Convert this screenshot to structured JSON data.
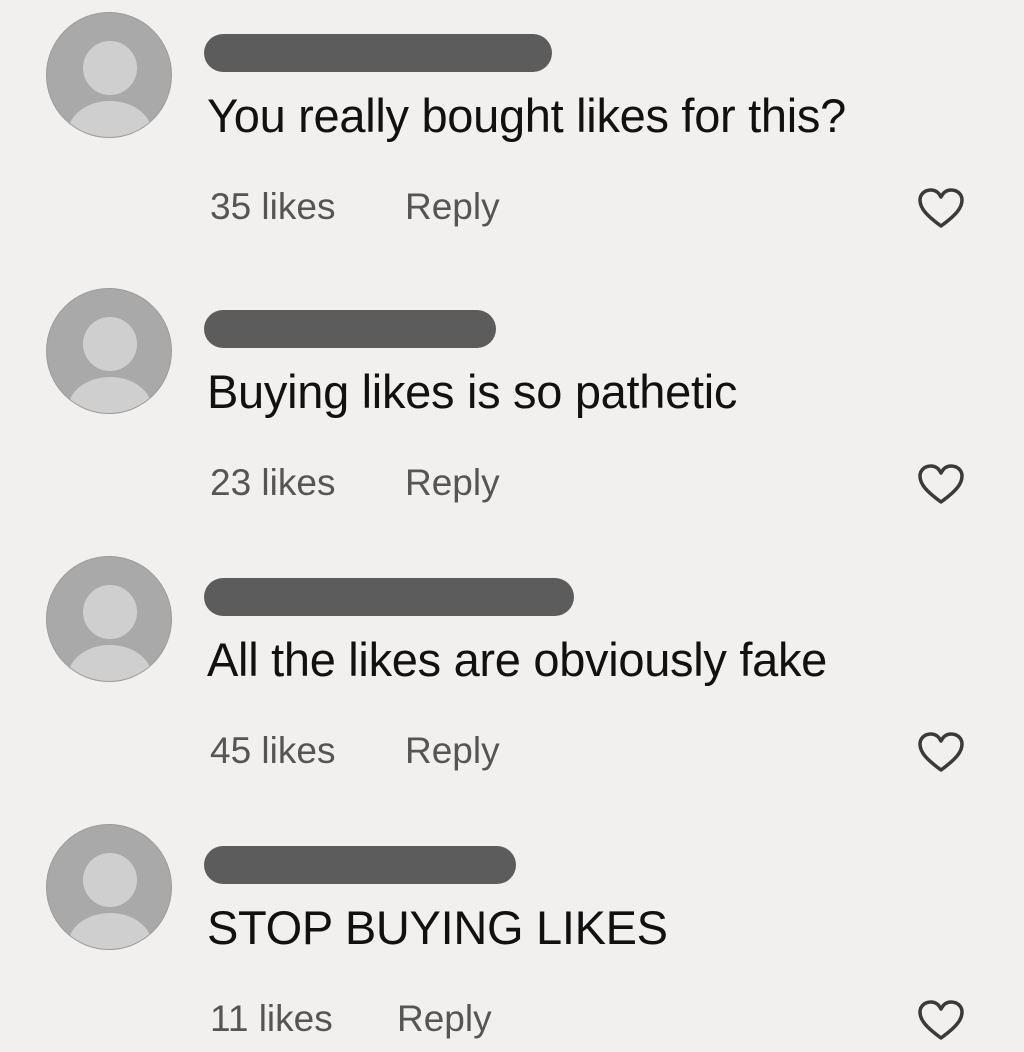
{
  "comments": [
    {
      "text": "You really bought likes for this?",
      "likes": "35 likes",
      "reply_label": "Reply",
      "avatar_icon": "default-avatar-icon",
      "like_icon": "heart-outline-icon"
    },
    {
      "text": "Buying likes is so pathetic",
      "likes": "23 likes",
      "reply_label": "Reply",
      "avatar_icon": "default-avatar-icon",
      "like_icon": "heart-outline-icon"
    },
    {
      "text": "All the likes are obviously fake",
      "likes": "45 likes",
      "reply_label": "Reply",
      "avatar_icon": "default-avatar-icon",
      "like_icon": "heart-outline-icon"
    },
    {
      "text": "STOP BUYING LIKES",
      "likes": "11 likes",
      "reply_label": "Reply",
      "avatar_icon": "default-avatar-icon",
      "like_icon": "heart-outline-icon"
    }
  ],
  "colors": {
    "background": "#f1f0ee",
    "username_redaction": "#5c5c5c",
    "avatar": "#a9a9a9",
    "meta_text": "#555555",
    "comment_text": "#111111"
  }
}
